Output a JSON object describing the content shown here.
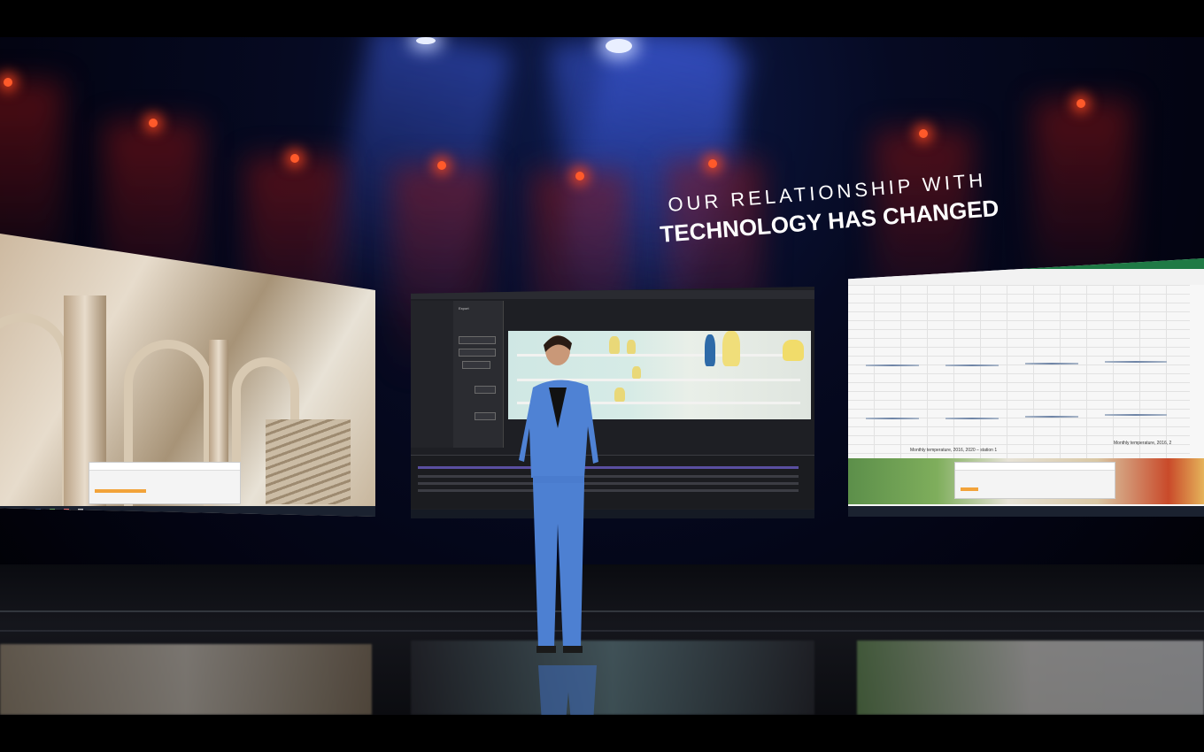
{
  "headline": {
    "line1": "OUR RELATIONSHIP WITH",
    "line2": "TECHNOLOGY HAS CHANGED"
  },
  "screens": {
    "left": {
      "subject": "ornate-architecture-render",
      "dialog_present": true
    },
    "middle": {
      "app": "video-editor",
      "panel_title": "Export"
    },
    "right": {
      "app": "spreadsheet",
      "chart_caption_left": "Monthly temperature, 2016, 2020 – station 1",
      "chart_caption_right": "Monthly temperature, 2016, 2"
    }
  },
  "colors": {
    "suit": "#4f82d4",
    "spreadsheet_accent": "#1f7a45",
    "stage_blue": "#0d1a4a",
    "red_lights": "#ff5a2a"
  },
  "icons": [
    "stage-spotlight-icon"
  ]
}
